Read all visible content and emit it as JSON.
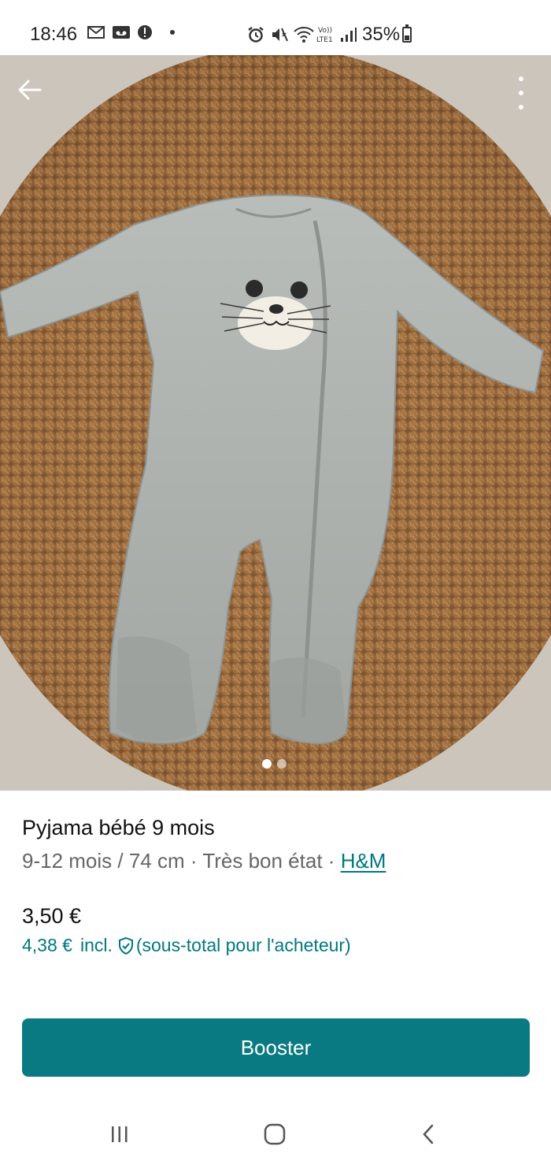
{
  "status_bar": {
    "time": "18:46",
    "battery": "35%",
    "battery_level": 0.35,
    "left_icons": [
      "gmail-icon",
      "voicemail-icon",
      "alert-icon",
      "dot-icon"
    ],
    "right_icons": [
      "alarm-icon",
      "mute-icon",
      "wifi-icon",
      "volte-icon",
      "signal-icon"
    ]
  },
  "gallery": {
    "image_count": 2,
    "active_index": 0
  },
  "product": {
    "title": "Pyjama bébé 9 mois",
    "size": "9-12 mois / 74 cm",
    "separator": "·",
    "condition": "Très bon état",
    "brand": "H&M",
    "price": "3,50 €",
    "price_incl": "4,38 €",
    "incl_label": "incl.",
    "buyer_note": "(sous-total pour l'acheteur)"
  },
  "actions": {
    "booster_label": "Booster"
  },
  "colors": {
    "accent": "#0a7a82",
    "link": "#007782"
  },
  "nav_bar": {
    "icons": [
      "recent-apps-icon",
      "home-icon",
      "back-nav-icon"
    ]
  }
}
